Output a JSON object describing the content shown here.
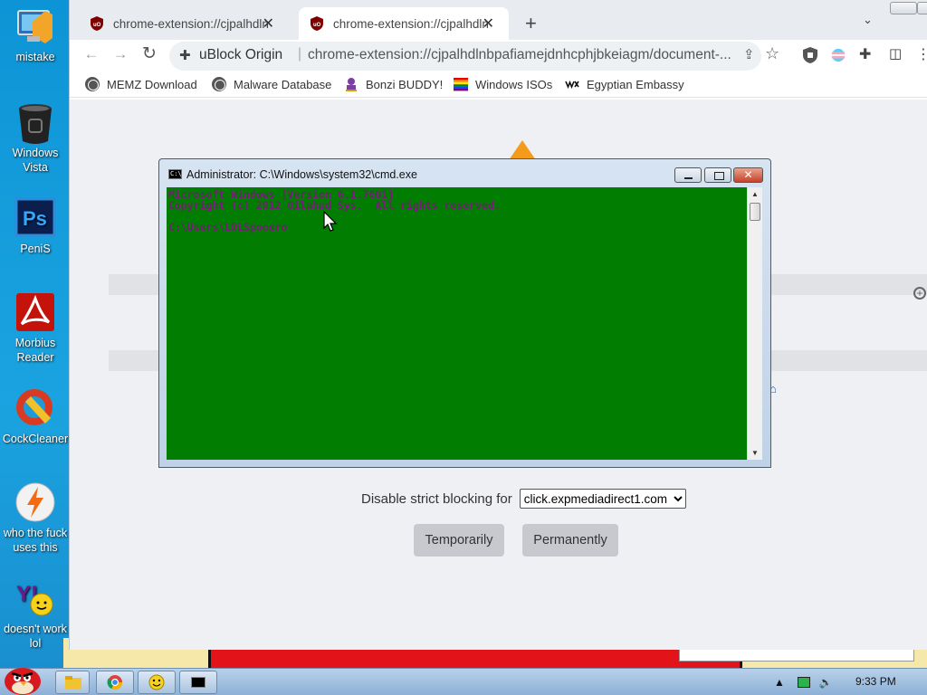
{
  "desktop": {
    "icons": [
      {
        "label": "mistake"
      },
      {
        "label": "Windows Vista"
      },
      {
        "label": "PeniS"
      },
      {
        "label": "Morbius Reader"
      },
      {
        "label": "CockCleaner"
      },
      {
        "label": "who the fuck uses this"
      },
      {
        "label": "doesn't work lol"
      }
    ]
  },
  "browser": {
    "tabs": [
      {
        "title": "chrome-extension://cjpalhdlnb",
        "active": false
      },
      {
        "title": "chrome-extension://cjpalhdlnb",
        "active": true
      }
    ],
    "address": {
      "site_chip": "uBlock Origin",
      "url": "chrome-extension://cjpalhdlnbpafiamejdnhcphjbkeiagm/document-..."
    },
    "bookmarks": [
      {
        "label": "MEMZ Download",
        "icon": "globe-icon"
      },
      {
        "label": "Malware Database",
        "icon": "globe-icon"
      },
      {
        "label": "Bonzi BUDDY!",
        "icon": "bonzi-icon"
      },
      {
        "label": "Windows ISOs",
        "icon": "rainbow-flag-icon"
      },
      {
        "label": "Egyptian Embassy",
        "icon": "wix-icon"
      }
    ]
  },
  "page": {
    "strict_label": "Disable strict blocking for",
    "strict_value": "click.expmediadirect1.com",
    "temporarily": "Temporarily",
    "permanently": "Permanently"
  },
  "cmd": {
    "title": "Administrator: C:\\Windows\\system32\\cmd.exe",
    "icon_text": "C:\\",
    "lines": [
      "Microsoft Windows [Version 6.1.7601]",
      "Copyright (c) 2012 Oilahud Sys.  All rights reserved.",
      "",
      "C:\\Users\\LOLSpooero"
    ],
    "background": "#017d01",
    "text_color": "#7b197c"
  },
  "taskbar": {
    "clock": "9:33 PM"
  },
  "colors": {
    "desktop": "#1aa3e0",
    "browser_frame": "#e8ecf1"
  }
}
